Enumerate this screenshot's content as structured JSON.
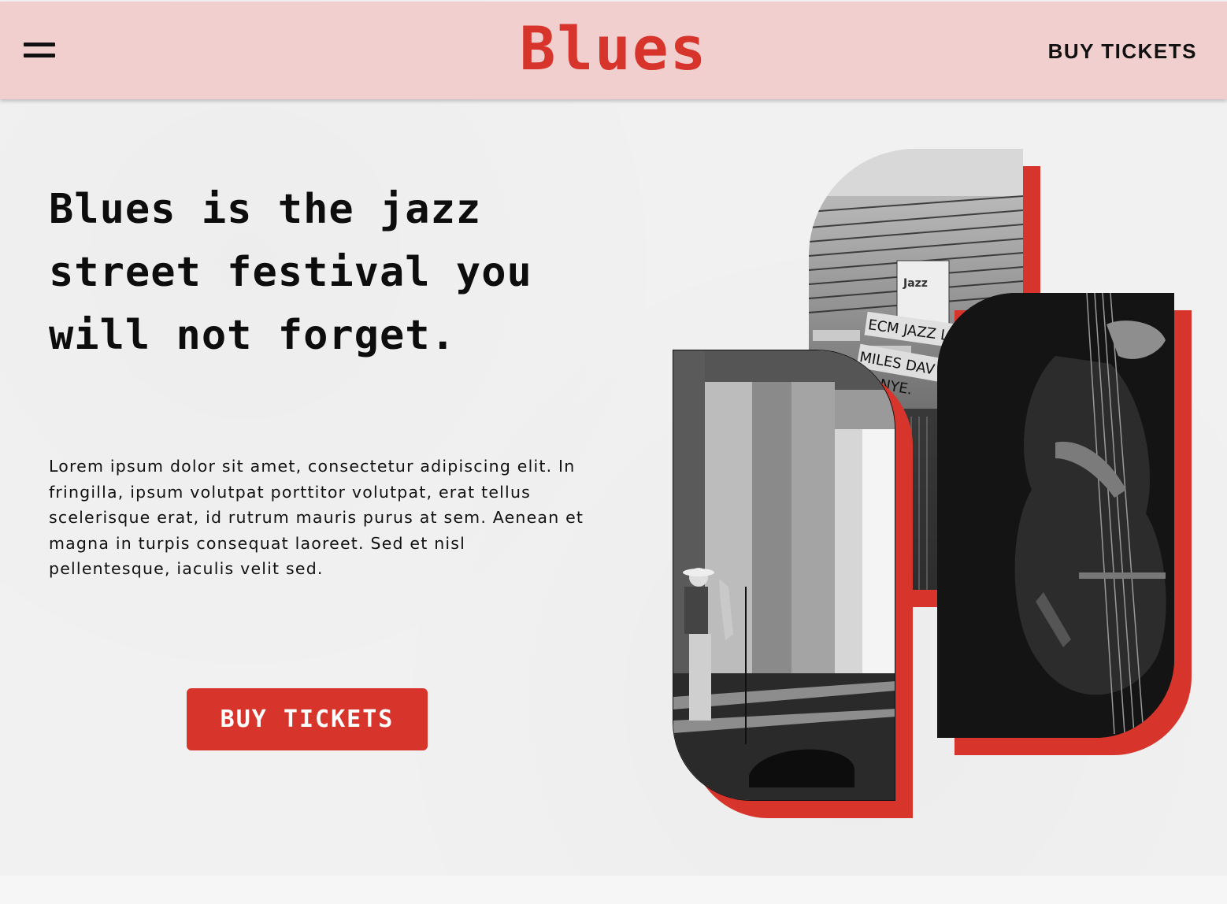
{
  "header": {
    "brand": "Blues",
    "cta_label": "BUY TICKETS",
    "menu_icon": "hamburger-menu-icon",
    "background": "#f2cfcf"
  },
  "hero": {
    "headline": "Blues is the jazz street festival you will not forget.",
    "body": "Lorem ipsum dolor sit amet, consectetur adipiscing elit. In fringilla, ipsum volutpat porttitor volutpat, erat tellus scelerisque erat, id rutrum mauris purus at sem. Aenean et magna in turpis consequat laoreet. Sed et nisl pellentesque, iaculis velit sed.",
    "cta_label": "BUY TICKETS"
  },
  "collage": {
    "images": [
      {
        "subject": "vinyl-records-photo",
        "signs": [
          "ECM JAZZ L",
          "MILES DAV",
          "NYE."
        ]
      },
      {
        "subject": "saxophonist-photo"
      },
      {
        "subject": "double-bass-photo"
      }
    ]
  },
  "colors": {
    "accent": "#d7342c",
    "text": "#111111",
    "page_bg": "#f1f1f1"
  }
}
